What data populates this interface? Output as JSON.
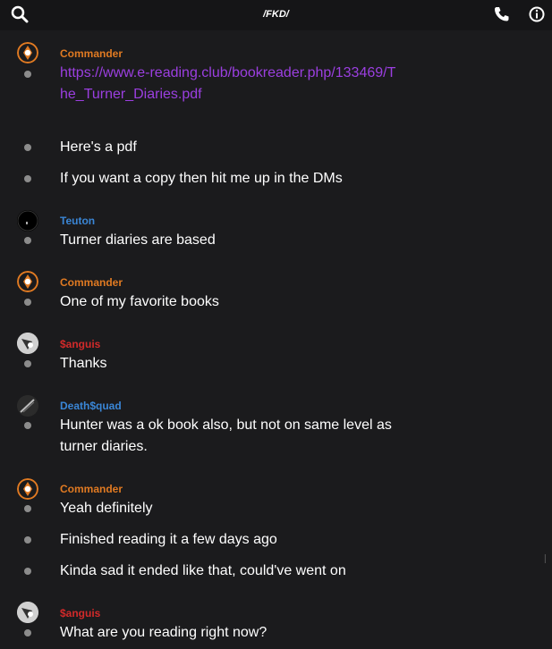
{
  "header": {
    "title": "/FKD/",
    "icons": [
      "search-icon",
      "phone-icon",
      "info-icon"
    ]
  },
  "colors": {
    "commander": "#e07a22",
    "teuton": "#3a86d6",
    "sanguis": "#d22a2a",
    "deathsquad": "#3a86d6",
    "link": "#9b3fe0"
  },
  "messages": [
    {
      "user": "Commander",
      "lines": [
        "https://www.e-reading.club/bookreader.php/133469/The_Turner_Diaries.pdf",
        "Here's a pdf",
        "If you want a copy then hit me up in the DMs"
      ]
    },
    {
      "user": "Teuton",
      "lines": [
        "Turner diaries are based"
      ]
    },
    {
      "user": "Commander",
      "lines": [
        "One of my favorite books"
      ]
    },
    {
      "user": "$anguis",
      "lines": [
        "Thanks"
      ]
    },
    {
      "user": "Death$quad",
      "lines": [
        "Hunter was a ok book also, but not on same level as turner diaries."
      ]
    },
    {
      "user": "Commander",
      "lines": [
        "Yeah definitely",
        "Finished reading it a few days ago",
        "Kinda sad it ended like that, could've went on"
      ]
    },
    {
      "user": "$anguis",
      "lines": [
        "What are you reading right now?"
      ]
    }
  ]
}
